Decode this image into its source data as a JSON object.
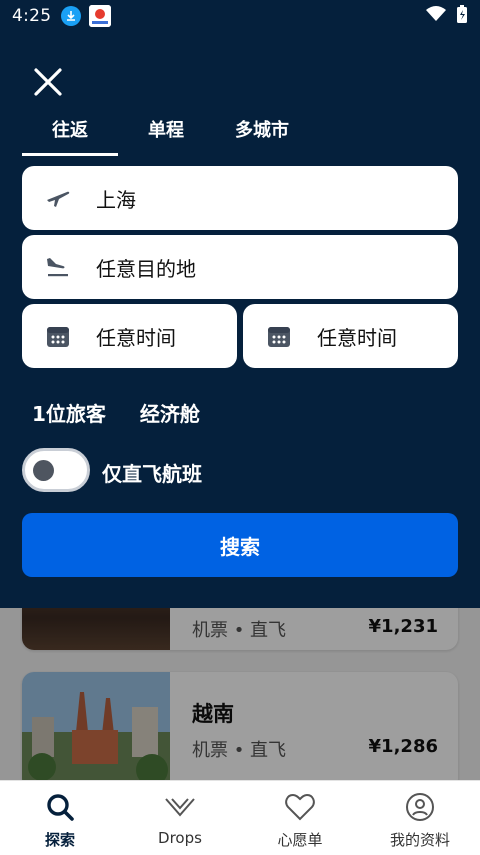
{
  "status_bar": {
    "time": "4:25"
  },
  "tabs": [
    {
      "label": "往返",
      "active": true
    },
    {
      "label": "单程",
      "active": false
    },
    {
      "label": "多城市",
      "active": false
    }
  ],
  "search": {
    "origin": "上海",
    "destination": "任意目的地",
    "depart_date": "任意时间",
    "return_date": "任意时间",
    "travelers": "1位旅客",
    "cabin_class": "经济舱",
    "direct_only_label": "仅直飞航班",
    "direct_only": false,
    "search_button": "搜索"
  },
  "results": [
    {
      "meta": "机票 • 直飞",
      "price": "¥1,231"
    },
    {
      "name": "越南",
      "meta": "机票 • 直飞",
      "price": "¥1,286"
    }
  ],
  "bottom_nav": [
    {
      "label": "探索",
      "icon": "search-icon",
      "active": true
    },
    {
      "label": "Drops",
      "icon": "drops-icon",
      "active": false
    },
    {
      "label": "心愿单",
      "icon": "heart-icon",
      "active": false
    },
    {
      "label": "我的资料",
      "icon": "profile-icon",
      "active": false
    }
  ],
  "colors": {
    "panel_bg": "#05203c",
    "primary": "#0062e3",
    "text_dark": "#111111"
  }
}
